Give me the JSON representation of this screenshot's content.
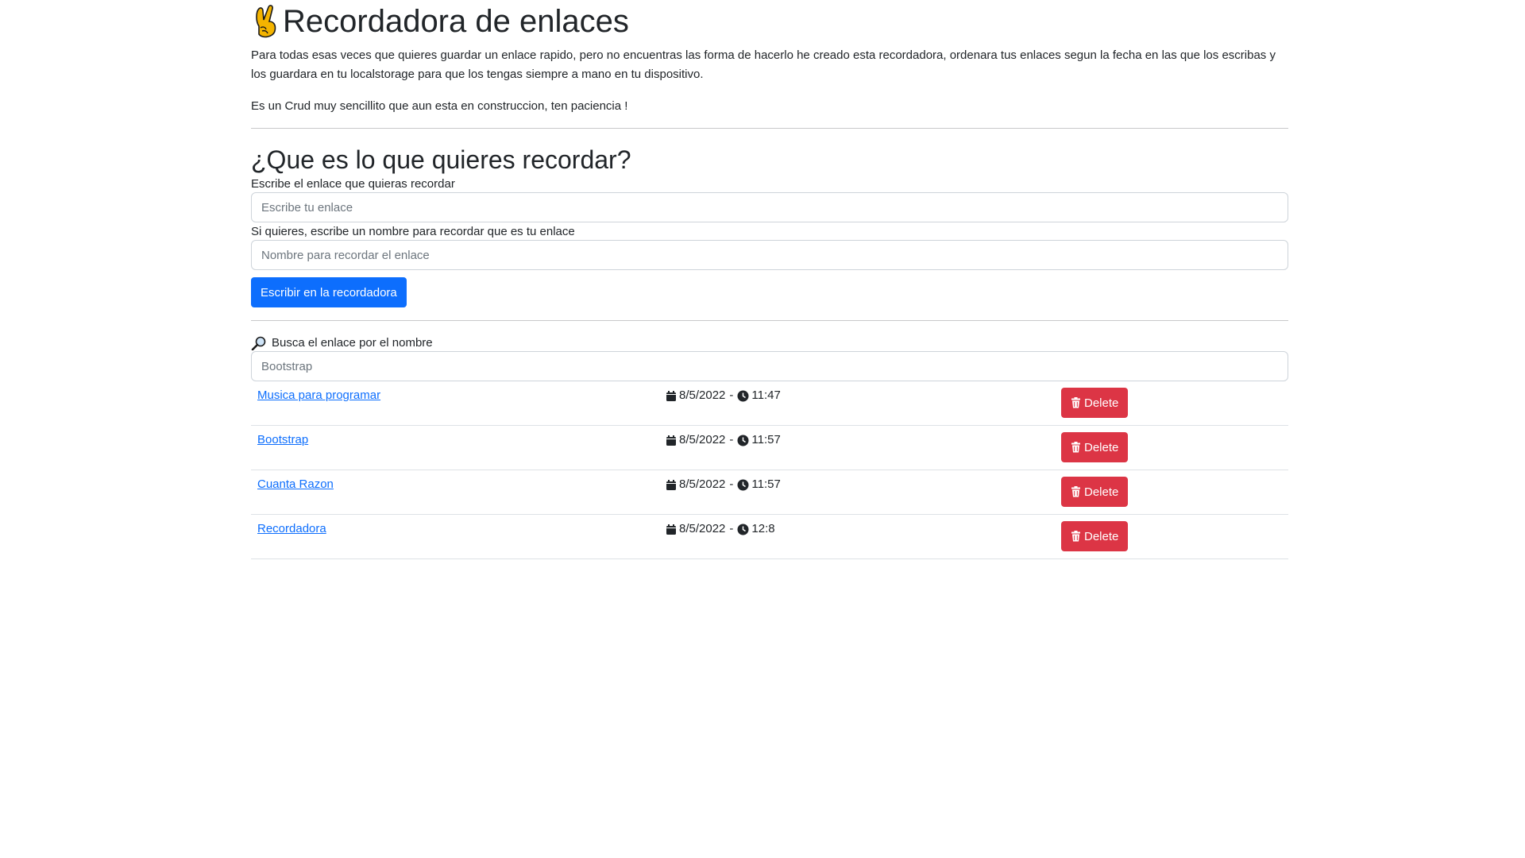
{
  "header": {
    "title": "Recordadora de enlaces",
    "title_icon": "crossed-fingers-icon",
    "intro": "Para todas esas veces que quieres guardar un enlace rapido, pero no encuentras las forma de hacerlo he creado esta recordadora, ordenara tus enlaces segun la fecha en las que los escribas y los guardara en tu localstorage para que los tengas siempre a mano en tu dispositivo.",
    "note": "Es un Crud muy sencillito que aun esta en construccion, ten paciencia !"
  },
  "form": {
    "heading": "¿Que es lo que quieres recordar?",
    "link_label": "Escribe el enlace que quieras recordar",
    "link_placeholder": "Escribe tu enlace",
    "name_label": "Si quieres, escribe un nombre para recordar que es tu enlace",
    "name_placeholder": "Nombre para recordar el enlace",
    "submit_label": "Escribir en la recordadora"
  },
  "search": {
    "label": "Busca el enlace por el nombre",
    "icon": "magnifier-icon",
    "value": "Bootstrap"
  },
  "links": [
    {
      "name": "Musica para programar",
      "date": "8/5/2022",
      "time": "11:47",
      "delete_label": "Delete"
    },
    {
      "name": "Bootstrap",
      "date": "8/5/2022",
      "time": "11:57",
      "delete_label": "Delete"
    },
    {
      "name": "Cuanta Razon",
      "date": "8/5/2022",
      "time": "11:57",
      "delete_label": "Delete"
    },
    {
      "name": "Recordadora",
      "date": "8/5/2022",
      "time": "12:8",
      "delete_label": "Delete"
    }
  ],
  "colors": {
    "primary": "#0d6efd",
    "danger": "#dc3545",
    "text": "#212529"
  }
}
